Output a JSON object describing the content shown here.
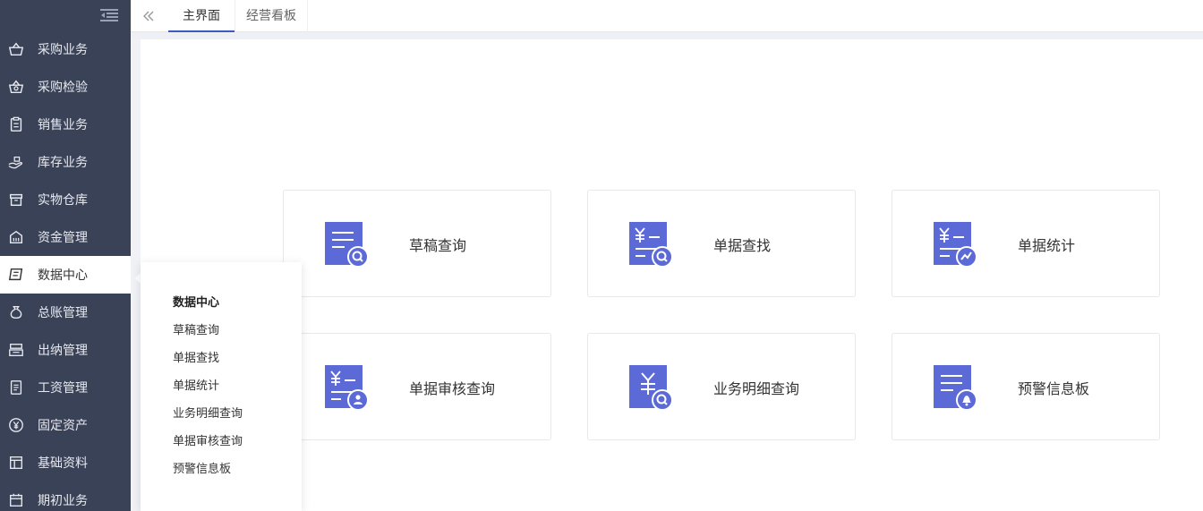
{
  "sidebar": {
    "items": [
      {
        "label": "采购业务",
        "icon": "basket-icon"
      },
      {
        "label": "采购检验",
        "icon": "basket-search-icon"
      },
      {
        "label": "销售业务",
        "icon": "clipboard-icon"
      },
      {
        "label": "库存业务",
        "icon": "hand-box-icon"
      },
      {
        "label": "实物仓库",
        "icon": "archive-icon"
      },
      {
        "label": "资金管理",
        "icon": "building-icon"
      },
      {
        "label": "数据中心",
        "icon": "scroll-icon"
      },
      {
        "label": "总账管理",
        "icon": "money-bag-icon"
      },
      {
        "label": "出纳管理",
        "icon": "cash-register-icon"
      },
      {
        "label": "工资管理",
        "icon": "document-icon"
      },
      {
        "label": "固定资产",
        "icon": "yen-circle-icon"
      },
      {
        "label": "基础资料",
        "icon": "layout-icon"
      },
      {
        "label": "期初业务",
        "icon": "calendar-icon"
      }
    ],
    "active_index": 6
  },
  "tabs": [
    {
      "label": "主界面",
      "active": true
    },
    {
      "label": "经营看板",
      "active": false
    }
  ],
  "cards": [
    {
      "label": "草稿查询",
      "icon": "draft-search-icon"
    },
    {
      "label": "单据查找",
      "icon": "bill-search-icon"
    },
    {
      "label": "单据统计",
      "icon": "bill-stats-icon"
    },
    {
      "label": "单据审核查询",
      "icon": "bill-audit-icon"
    },
    {
      "label": "业务明细查询",
      "icon": "business-detail-icon"
    },
    {
      "label": "预警信息板",
      "icon": "warning-board-icon"
    }
  ],
  "popover": {
    "title": "数据中心",
    "items": [
      "草稿查询",
      "单据查找",
      "单据统计",
      "业务明细查询",
      "单据审核查询",
      "预警信息板"
    ]
  },
  "colors": {
    "sidebar_bg": "#3a4257",
    "accent": "#5b6ad6",
    "tab_underline": "#3b5bbf"
  }
}
